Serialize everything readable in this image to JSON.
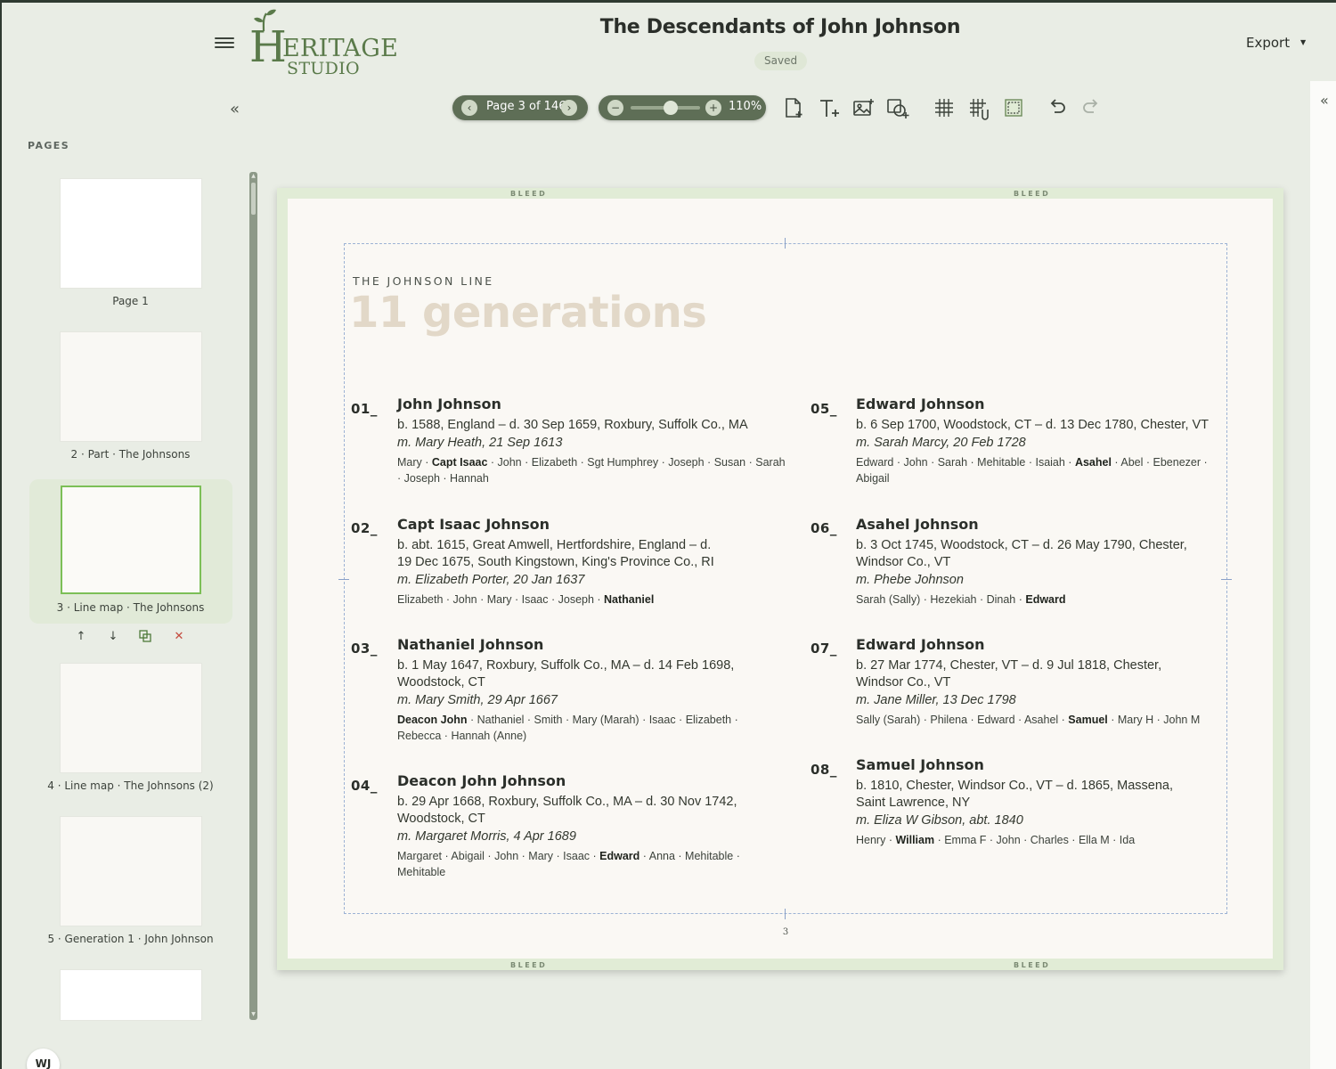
{
  "app": {
    "logo_initial": "H",
    "logo_word": "ERITAGE",
    "logo_sub": "STUDIO",
    "document_title": "The Descendants of John Johnson",
    "save_status": "Saved",
    "export_label": "Export",
    "accent_color": "#5e6e56"
  },
  "toolbar": {
    "page_indicator": "Page 3 of 146",
    "zoom_label": "110%",
    "zoom_level_percent": 110,
    "tools": [
      "add-page-icon",
      "add-text-icon",
      "add-image-icon",
      "add-shape-icon",
      "grid-icon",
      "snap-grid-icon",
      "bleed-frame-icon",
      "undo-icon",
      "redo-icon"
    ]
  },
  "sidebar": {
    "heading": "PAGES",
    "pages": [
      {
        "label": "Page 1"
      },
      {
        "label": "2 · Part · The Johnsons"
      },
      {
        "label": "3 · Line map · The Johnsons",
        "active": true
      },
      {
        "label": "4 · Line map · The Johnsons (2)"
      },
      {
        "label": "5 · Generation 1 · John Johnson"
      }
    ],
    "page_actions": [
      "move-up-icon",
      "move-down-icon",
      "duplicate-icon",
      "delete-icon"
    ],
    "user_initials": "WJ"
  },
  "canvas": {
    "bleed_label": "BLEED",
    "eyebrow": "THE JOHNSON LINE",
    "title": "11 generations",
    "page_number": "3",
    "generations": [
      {
        "num": "01_",
        "name": "John Johnson",
        "life": "b. 1588, England – d. 30 Sep 1659, Roxbury, Suffolk Co., MA",
        "marriage": "m. Mary Heath, 21 Sep 1613",
        "children_before": "Mary · ",
        "children_bold": "Capt Isaac",
        "children_after": " · John · Elizabeth · Sgt Humphrey · Joseph · Susan · Sarah · Joseph · Hannah"
      },
      {
        "num": "02_",
        "name": "Capt Isaac Johnson",
        "life": "b. abt. 1615, Great Amwell, Hertfordshire, England – d. 19 Dec 1675, South Kingstown, King's Province Co., RI",
        "marriage": "m. Elizabeth Porter, 20 Jan 1637",
        "children_before": "Elizabeth · John · Mary · Isaac · Joseph · ",
        "children_bold": "Nathaniel",
        "children_after": ""
      },
      {
        "num": "03_",
        "name": "Nathaniel Johnson",
        "life": "b. 1 May 1647, Roxbury, Suffolk Co., MA – d. 14 Feb 1698, Woodstock, CT",
        "marriage": "m. Mary Smith, 29 Apr 1667",
        "children_before": "",
        "children_bold": "Deacon John",
        "children_after": " · Nathaniel · Smith · Mary (Marah) · Isaac · Elizabeth · Rebecca · Hannah (Anne)"
      },
      {
        "num": "04_",
        "name": "Deacon John Johnson",
        "life": "b. 29 Apr 1668, Roxbury, Suffolk Co., MA – d. 30 Nov 1742, Woodstock, CT",
        "marriage": "m. Margaret Morris, 4 Apr 1689",
        "children_before": "Margaret · Abigail · John · Mary · Isaac · ",
        "children_bold": "Edward",
        "children_after": " · Anna · Mehitable · Mehitable"
      },
      {
        "num": "05_",
        "name": "Edward Johnson",
        "life": "b. 6 Sep 1700, Woodstock, CT – d. 13 Dec 1780, Chester, VT",
        "marriage": "m. Sarah Marcy, 20 Feb 1728",
        "children_before": "Edward · John · Sarah · Mehitable · Isaiah · ",
        "children_bold": "Asahel",
        "children_after": " · Abel · Ebenezer · Abigail"
      },
      {
        "num": "06_",
        "name": "Asahel Johnson",
        "life": "b. 3 Oct 1745, Woodstock, CT – d. 26 May 1790, Chester, Windsor Co., VT",
        "marriage": "m. Phebe Johnson",
        "children_before": "Sarah (Sally) · Hezekiah · Dinah · ",
        "children_bold": "Edward",
        "children_after": ""
      },
      {
        "num": "07_",
        "name": "Edward Johnson",
        "life": "b. 27 Mar 1774, Chester, VT – d. 9 Jul 1818, Chester, Windsor Co., VT",
        "marriage": "m. Jane Miller, 13 Dec 1798",
        "children_before": "Sally (Sarah) · Philena · Edward · Asahel · ",
        "children_bold": "Samuel",
        "children_after": " · Mary H · John M"
      },
      {
        "num": "08_",
        "name": "Samuel Johnson",
        "life": "b. 1810, Chester, Windsor Co., VT – d. 1865, Massena, Saint Lawrence, NY",
        "marriage": "m. Eliza W Gibson, abt. 1840",
        "children_before": "Henry · ",
        "children_bold": "William",
        "children_after": " · Emma F · John · Charles · Ella M · Ida"
      }
    ]
  }
}
